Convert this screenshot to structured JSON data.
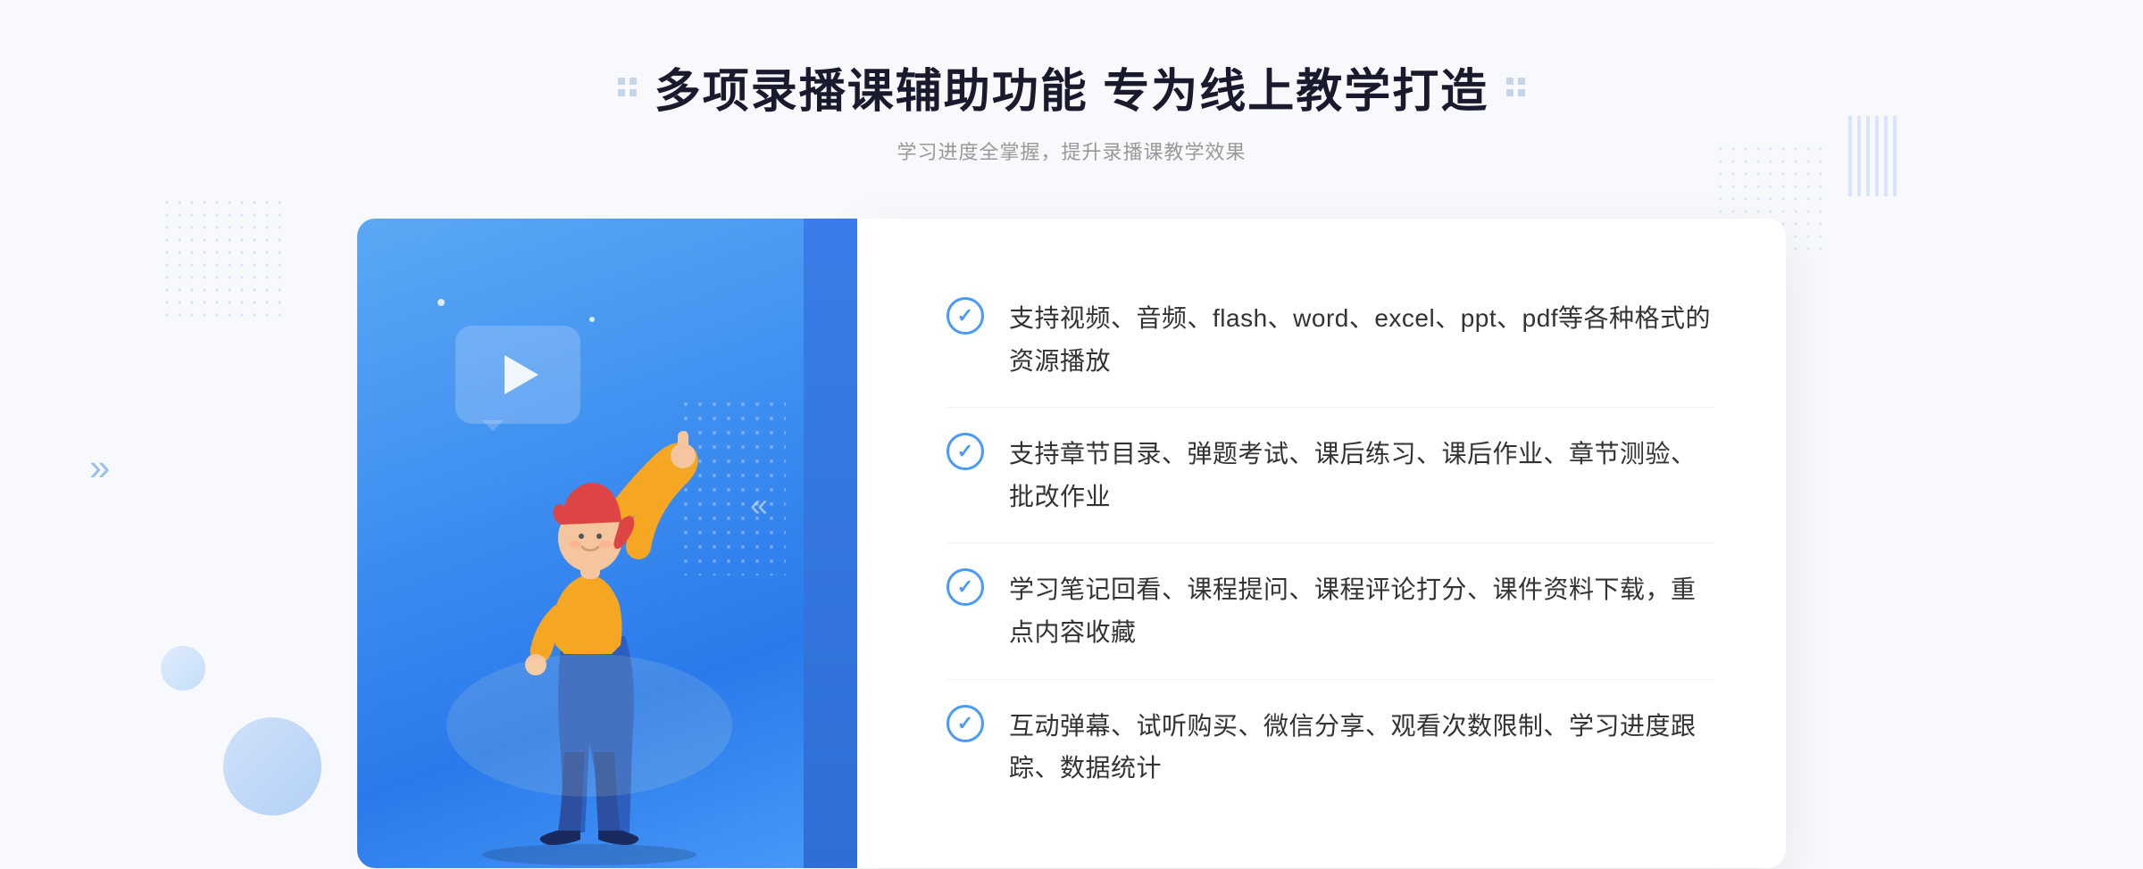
{
  "header": {
    "title": "多项录播课辅助功能 专为线上教学打造",
    "subtitle": "学习进度全掌握，提升录播课教学效果",
    "deco_left": "❖",
    "deco_right": "❖"
  },
  "features": [
    {
      "id": 1,
      "text": "支持视频、音频、flash、word、excel、ppt、pdf等各种格式的资源播放"
    },
    {
      "id": 2,
      "text": "支持章节目录、弹题考试、课后练习、课后作业、章节测验、批改作业"
    },
    {
      "id": 3,
      "text": "学习笔记回看、课程提问、课程评论打分、课件资料下载，重点内容收藏"
    },
    {
      "id": 4,
      "text": "互动弹幕、试听购买、微信分享、观看次数限制、学习进度跟踪、数据统计"
    }
  ],
  "colors": {
    "brand_blue": "#4a9af8",
    "dark_blue": "#2d6fd4",
    "light_blue_bg": "#f0f5ff",
    "text_dark": "#1a1a2e",
    "text_gray": "#999999",
    "text_body": "#333333"
  },
  "arrows": {
    "left": "»",
    "panel": "«"
  }
}
